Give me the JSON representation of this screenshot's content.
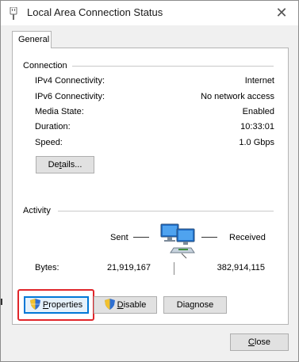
{
  "window": {
    "title": "Local Area Connection Status",
    "close_glyph": "✕"
  },
  "tabs": [
    {
      "label": "General"
    }
  ],
  "connection": {
    "group_title": "Connection",
    "rows": [
      {
        "label": "IPv4 Connectivity:",
        "value": "Internet"
      },
      {
        "label": "IPv6 Connectivity:",
        "value": "No network access"
      },
      {
        "label": "Media State:",
        "value": "Enabled"
      },
      {
        "label": "Duration:",
        "value": "10:33:01"
      },
      {
        "label": "Speed:",
        "value": "1.0 Gbps"
      }
    ],
    "details_button": {
      "pre": "De",
      "accel": "t",
      "post": "ails..."
    }
  },
  "activity": {
    "group_title": "Activity",
    "sent_label": "Sent",
    "received_label": "Received",
    "bytes_label": "Bytes:",
    "sent_bytes": "21,919,167",
    "received_bytes": "382,914,115"
  },
  "actions": {
    "properties": {
      "accel": "P",
      "rest": "roperties"
    },
    "disable": {
      "accel": "D",
      "rest": "isable"
    },
    "diagnose": {
      "label": "Diagnose"
    }
  },
  "footer": {
    "close": {
      "accel": "C",
      "rest": "lose"
    }
  },
  "colors": {
    "highlight": "#e0262b",
    "focus": "#0078d7",
    "title_bg": "#ffffff",
    "dialog_bg": "#f0f0f0"
  },
  "icons": [
    "network-adapter-icon",
    "shield-icon",
    "network-computers-icon",
    "close-icon"
  ]
}
